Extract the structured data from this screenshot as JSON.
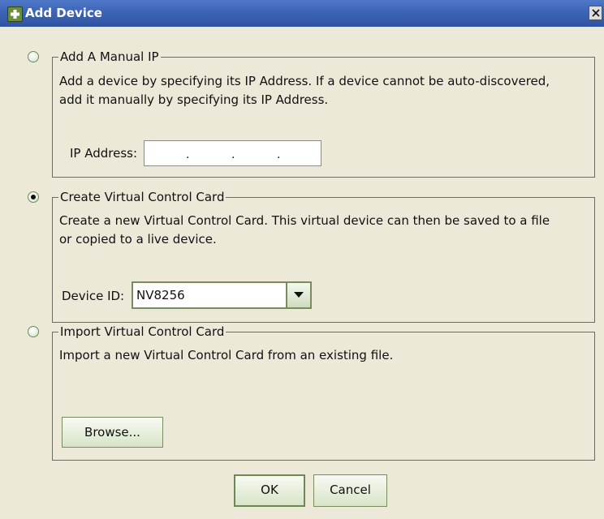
{
  "window": {
    "title": "Add Device"
  },
  "options": [
    {
      "label": "Add A Manual IP",
      "selected": false,
      "description": [
        "Add a device by specifying its IP Address. If a device cannot be auto-discovered,",
        "add it manually by specifying its IP Address."
      ],
      "field_label": "IP Address:",
      "ip_dots": [
        ".",
        ".",
        "."
      ]
    },
    {
      "label": "Create Virtual Control Card",
      "selected": true,
      "description": [
        "Create a new Virtual Control Card. This virtual device can then be saved to a file",
        "or copied to a live device."
      ],
      "field_label": "Device ID:",
      "device_id": "NV8256"
    },
    {
      "label": "Import Virtual Control Card",
      "selected": false,
      "description": [
        "Import a new Virtual Control Card from an existing file."
      ],
      "browse_label": "Browse..."
    }
  ],
  "buttons": {
    "ok": "OK",
    "cancel": "Cancel"
  }
}
